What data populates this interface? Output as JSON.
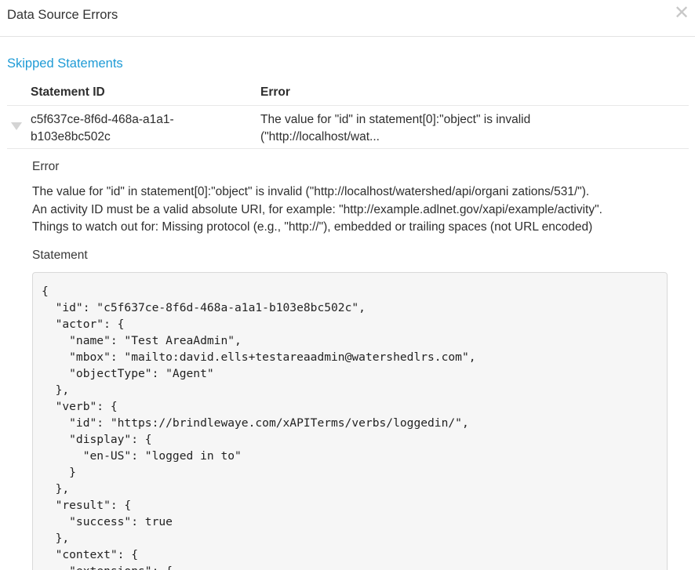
{
  "modal": {
    "title": "Data Source Errors",
    "close_glyph": "✕"
  },
  "section": {
    "title": "Skipped Statements"
  },
  "table": {
    "headers": [
      "Statement ID",
      "Error"
    ],
    "rows": [
      {
        "id_line1": "c5f637ce-8f6d-468a-a1a1-",
        "id_line2": "b103e8bc502c",
        "error_line1": "The value for \"id\" in statement[0]:\"object\" is invalid",
        "error_line2": "(\"http://localhost/wat..."
      }
    ]
  },
  "detail": {
    "error_label": "Error",
    "error_lines": [
      "The value for \"id\" in statement[0]:\"object\" is invalid (\"http://localhost/watershed/api/organi zations/531/\").",
      "An activity ID must be a valid absolute URI, for example: \"http://example.adlnet.gov/xapi/example/activity\".",
      "Things to watch out for: Missing protocol (e.g., \"http://\"), embedded or trailing spaces (not URL encoded)"
    ],
    "statement_label": "Statement",
    "statement_code": "{\n  \"id\": \"c5f637ce-8f6d-468a-a1a1-b103e8bc502c\",\n  \"actor\": {\n    \"name\": \"Test AreaAdmin\",\n    \"mbox\": \"mailto:david.ells+testareaadmin@watershedlrs.com\",\n    \"objectType\": \"Agent\"\n  },\n  \"verb\": {\n    \"id\": \"https://brindlewaye.com/xAPITerms/verbs/loggedin/\",\n    \"display\": {\n      \"en-US\": \"logged in to\"\n    }\n  },\n  \"result\": {\n    \"success\": true\n  },\n  \"context\": {\n    \"extensions\": {"
  },
  "colors": {
    "accent": "#1f9bd6",
    "text": "#2e2e2e",
    "code_bg": "#f6f6f6"
  }
}
